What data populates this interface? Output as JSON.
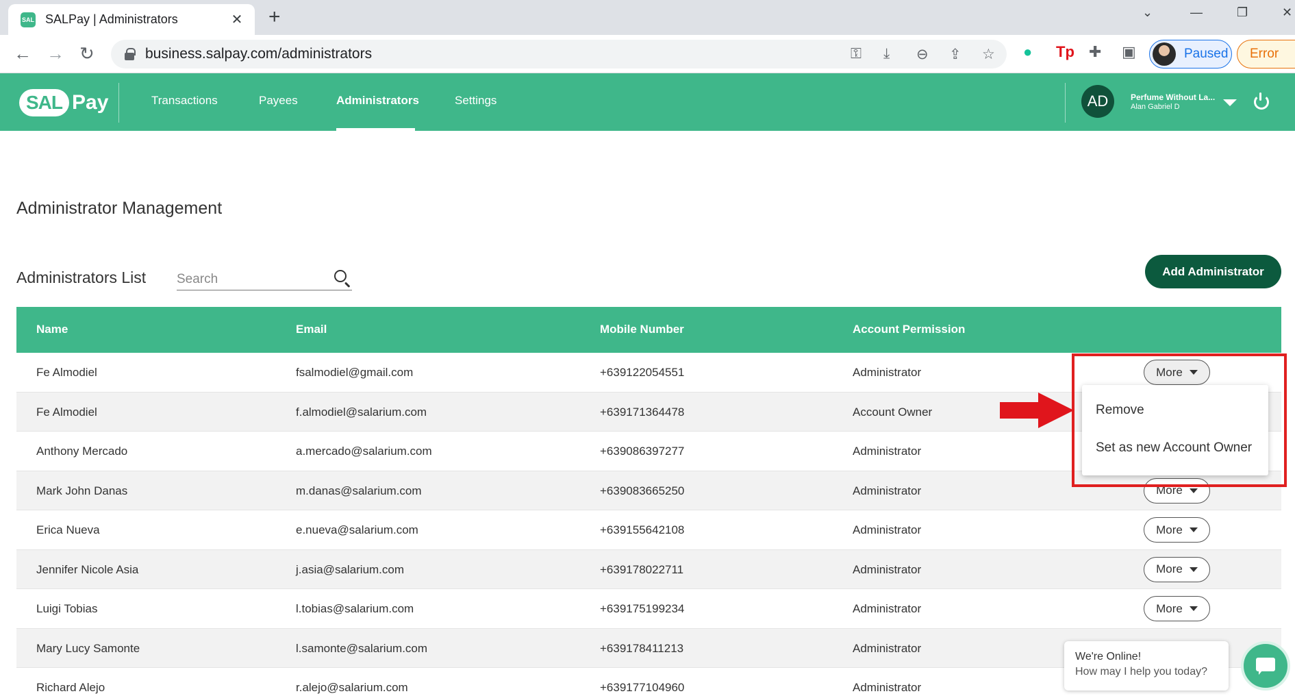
{
  "browser": {
    "tab_title": "SALPay | Administrators",
    "favicon_text": "SAL",
    "url": "business.salpay.com/administrators",
    "profile_label": "Paused",
    "error_label": "Error",
    "window_controls": [
      "chevron-down-icon",
      "minimize-icon",
      "restore-icon",
      "close-icon"
    ],
    "extension_icons": [
      "grammarly-icon",
      "tp-icon",
      "puzzle-icon",
      "sidepanel-icon"
    ]
  },
  "header": {
    "logo_sal": "SAL",
    "logo_pay": "Pay",
    "nav": [
      "Transactions",
      "Payees",
      "Administrators",
      "Settings"
    ],
    "active_nav": "Administrators",
    "user_initials": "AD",
    "company": "Perfume Without La...",
    "user_name": "Alan Gabriel D",
    "brand_color": "#3fb78a",
    "dark_green": "#0c5a3e"
  },
  "page": {
    "title": "Administrator Management",
    "list_title": "Administrators List",
    "search_placeholder": "Search",
    "add_button": "Add Administrator"
  },
  "table": {
    "columns": [
      "Name",
      "Email",
      "Mobile Number",
      "Account Permission"
    ],
    "rows": [
      {
        "name": "Fe Almodiel",
        "email": "fsalmodiel@gmail.com",
        "mobile": "+639122054551",
        "permission": "Administrator",
        "action": "More"
      },
      {
        "name": "Fe Almodiel",
        "email": "f.almodiel@salarium.com",
        "mobile": "+639171364478",
        "permission": "Account Owner",
        "action": ""
      },
      {
        "name": "Anthony Mercado",
        "email": "a.mercado@salarium.com",
        "mobile": "+639086397277",
        "permission": "Administrator",
        "action": ""
      },
      {
        "name": "Mark John Danas",
        "email": "m.danas@salarium.com",
        "mobile": "+639083665250",
        "permission": "Administrator",
        "action": "More"
      },
      {
        "name": "Erica Nueva",
        "email": "e.nueva@salarium.com",
        "mobile": "+639155642108",
        "permission": "Administrator",
        "action": "More"
      },
      {
        "name": "Jennifer Nicole Asia",
        "email": "j.asia@salarium.com",
        "mobile": "+639178022711",
        "permission": "Administrator",
        "action": "More"
      },
      {
        "name": "Luigi Tobias",
        "email": "l.tobias@salarium.com",
        "mobile": "+639175199234",
        "permission": "Administrator",
        "action": "More"
      },
      {
        "name": "Mary Lucy Samonte",
        "email": "l.samonte@salarium.com",
        "mobile": "+639178411213",
        "permission": "Administrator",
        "action": ""
      },
      {
        "name": "Richard Alejo",
        "email": "r.alejo@salarium.com",
        "mobile": "+639177104960",
        "permission": "Administrator",
        "action": ""
      }
    ]
  },
  "dropdown": {
    "items": [
      "Remove",
      "Set as new Account Owner"
    ]
  },
  "chat": {
    "line1": "We're Online!",
    "line2": "How may I help you today?"
  }
}
